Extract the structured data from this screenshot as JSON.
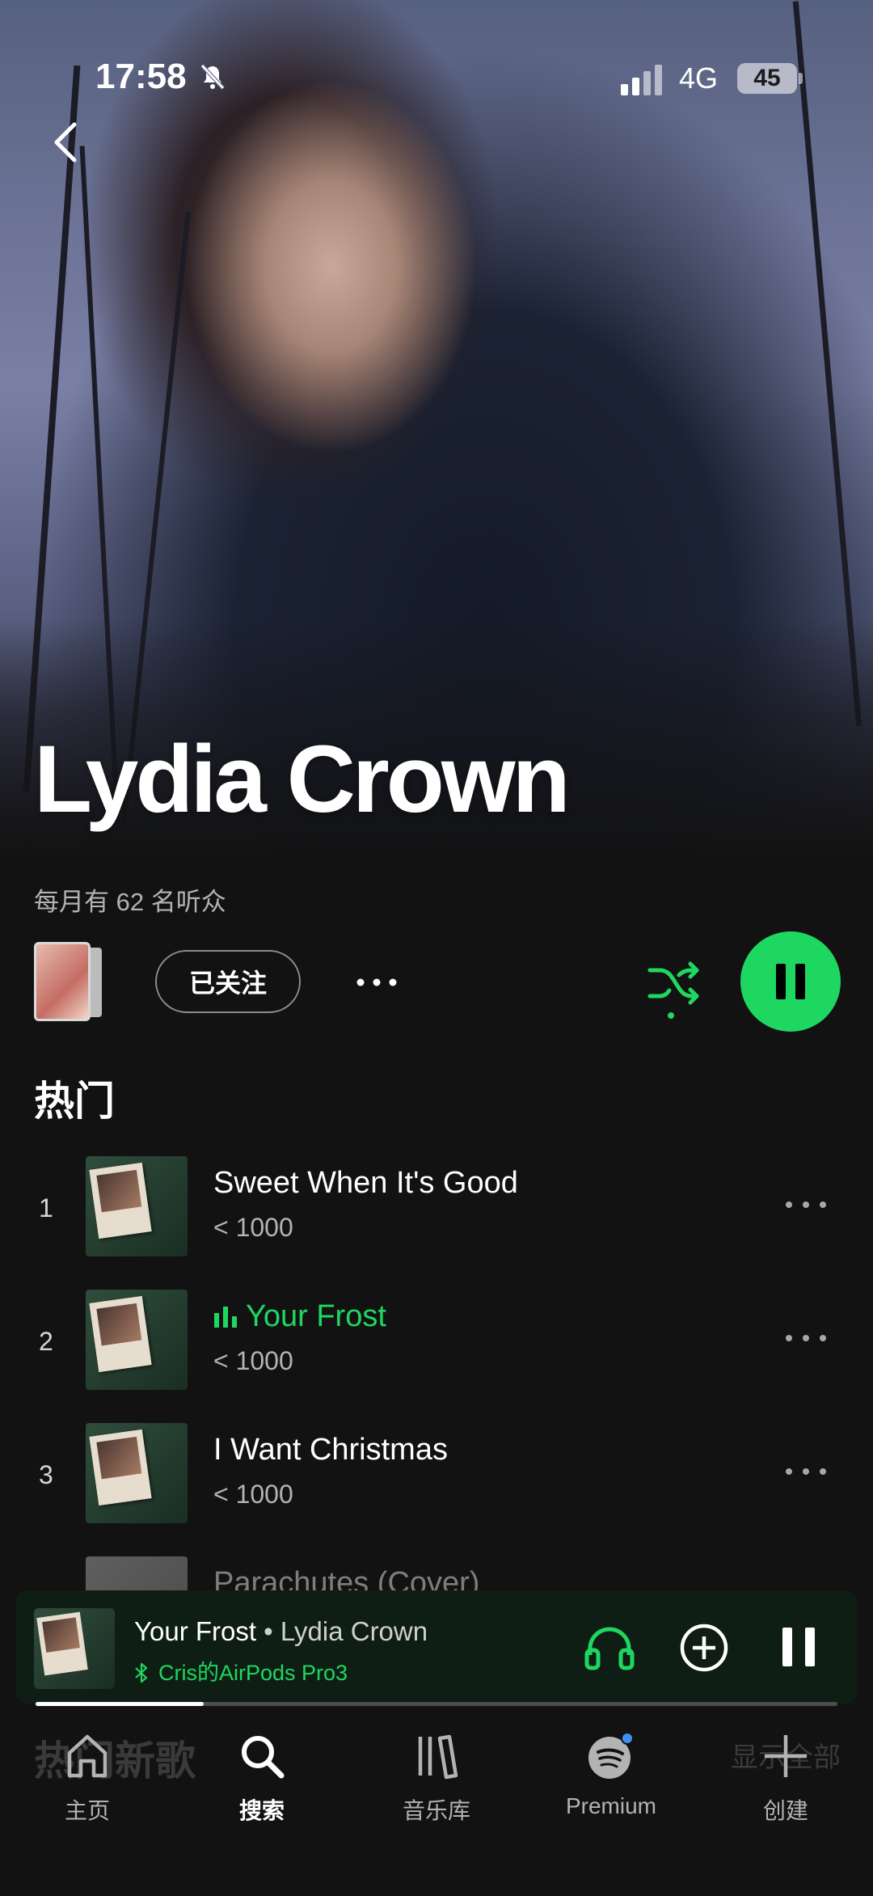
{
  "status_bar": {
    "time": "17:58",
    "network": "4G",
    "battery": "45"
  },
  "artist": {
    "name": "Lydia Crown",
    "monthly_listeners": "每月有 62 名听众",
    "follow_label": "已关注"
  },
  "section_title": "热门",
  "tracks": [
    {
      "num": "1",
      "title": "Sweet When It's Good",
      "plays": "< 1000",
      "playing": false
    },
    {
      "num": "2",
      "title": "Your Frost",
      "plays": "< 1000",
      "playing": true
    },
    {
      "num": "3",
      "title": "I Want Christmas",
      "plays": "< 1000",
      "playing": false
    },
    {
      "num": "",
      "title": "Parachutes (Cover)",
      "plays": "",
      "playing": false
    }
  ],
  "now_playing": {
    "title": "Your Frost",
    "separator": " • ",
    "artist": "Lydia Crown",
    "device": "Cris的AirPods Pro3",
    "progress": 0.21
  },
  "behind_nav": {
    "left": "热门新歌",
    "right": "显示全部"
  },
  "nav": [
    {
      "label": "主页",
      "icon": "home-icon",
      "active": false
    },
    {
      "label": "搜索",
      "icon": "search-icon",
      "active": true
    },
    {
      "label": "音乐库",
      "icon": "library-icon",
      "active": false
    },
    {
      "label": "Premium",
      "icon": "spotify-icon",
      "active": false
    },
    {
      "label": "创建",
      "icon": "plus-icon",
      "active": false
    }
  ],
  "colors": {
    "accent": "#1ed760",
    "background": "#121212",
    "notification_dot": "#3d91f4"
  }
}
